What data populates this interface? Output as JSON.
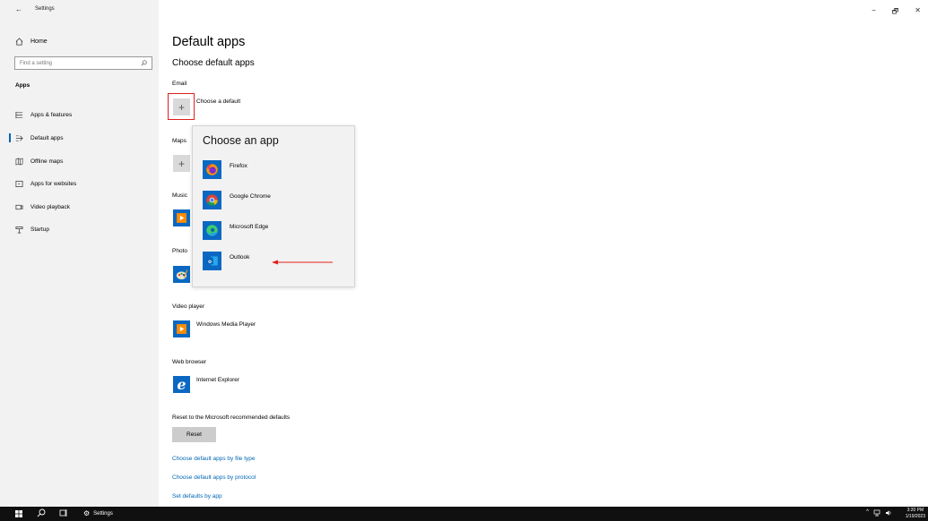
{
  "window": {
    "title": "Settings",
    "back_glyph": "←",
    "minimize_glyph": "−",
    "maximize_glyph": "🗗",
    "close_glyph": "✕"
  },
  "sidebar": {
    "home_label": "Home",
    "search_placeholder": "Find a setting",
    "section_label": "Apps",
    "items": [
      {
        "label": "Apps & features",
        "icon": "list-icon"
      },
      {
        "label": "Default apps",
        "icon": "default-apps-icon"
      },
      {
        "label": "Offline maps",
        "icon": "map-icon"
      },
      {
        "label": "Apps for websites",
        "icon": "websites-icon"
      },
      {
        "label": "Video playback",
        "icon": "video-icon"
      },
      {
        "label": "Startup",
        "icon": "startup-icon"
      }
    ]
  },
  "main": {
    "title": "Default apps",
    "subtitle": "Choose default apps",
    "email": {
      "label": "Email",
      "value": "Choose a default"
    },
    "maps": {
      "label": "Maps"
    },
    "music": {
      "label": "Music"
    },
    "photo": {
      "label": "Photo"
    },
    "video_player": {
      "label": "Video player",
      "value": "Windows Media Player"
    },
    "web_browser": {
      "label": "Web browser",
      "value": "Internet Explorer"
    },
    "reset_label": "Reset to the Microsoft recommended defaults",
    "reset_button": "Reset",
    "links": [
      "Choose default apps by file type",
      "Choose default apps by protocol",
      "Set defaults by app"
    ]
  },
  "flyout": {
    "title": "Choose an app",
    "apps": [
      {
        "label": "Firefox",
        "icon": "firefox-icon"
      },
      {
        "label": "Google Chrome",
        "icon": "chrome-icon"
      },
      {
        "label": "Microsoft Edge",
        "icon": "edge-icon"
      },
      {
        "label": "Outlook",
        "icon": "outlook-icon"
      }
    ]
  },
  "taskbar": {
    "app_label": "Settings",
    "time": "3:20 PM",
    "date": "1/19/2023"
  },
  "colors": {
    "accent": "#0063b1",
    "highlight": "#e0201b",
    "link": "#0066b4"
  }
}
